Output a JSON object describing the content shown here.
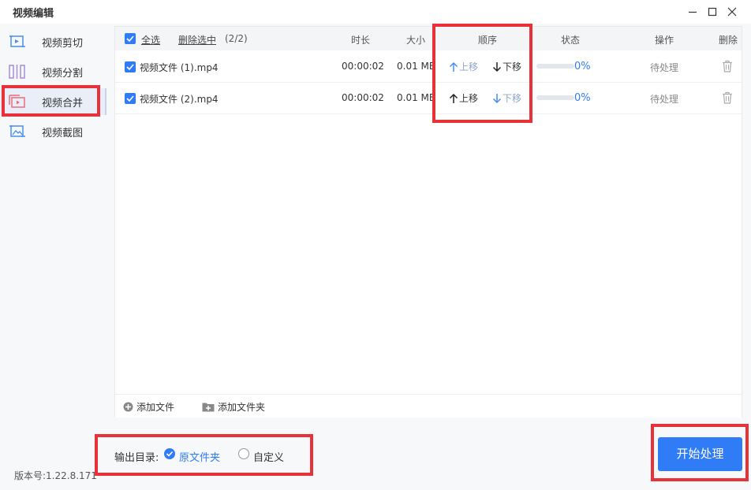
{
  "window": {
    "title": "视频编辑",
    "controls": [
      "minimize-icon",
      "maximize-icon",
      "close-icon"
    ]
  },
  "sidebar": {
    "items": [
      {
        "label": "视频剪切",
        "icon": "video-cut-icon"
      },
      {
        "label": "视频分割",
        "icon": "video-split-icon"
      },
      {
        "label": "视频合并",
        "icon": "video-merge-icon",
        "active": true
      },
      {
        "label": "视频截图",
        "icon": "video-screenshot-icon"
      }
    ]
  },
  "table": {
    "select_all": "全选",
    "delete_selected": "删除选中",
    "selected_count": "(2/2)",
    "columns": {
      "duration": "时长",
      "size": "大小",
      "order": "顺序",
      "status": "状态",
      "action": "操作",
      "delete": "删除"
    },
    "rows": [
      {
        "name": "视频文件 (1).mp4",
        "duration": "00:00:02",
        "size": "0.01 MB",
        "up": "上移",
        "down": "下移",
        "up_enabled": false,
        "down_enabled": true,
        "progress_percent": 0,
        "progress_text": "0%",
        "action": "待处理"
      },
      {
        "name": "视频文件 (2).mp4",
        "duration": "00:00:02",
        "size": "0.01 MB",
        "up": "上移",
        "down": "下移",
        "up_enabled": true,
        "down_enabled": false,
        "progress_percent": 0,
        "progress_text": "0%",
        "action": "待处理"
      }
    ]
  },
  "panel_footer": {
    "add_file": "添加文件",
    "add_folder": "添加文件夹"
  },
  "output": {
    "label": "输出目录:",
    "options": [
      {
        "label": "原文件夹",
        "selected": true
      },
      {
        "label": "自定义",
        "selected": false
      }
    ]
  },
  "version": "版本号:1.22.8.171",
  "start_button": "开始处理",
  "colors": {
    "accent": "#2f7cf6",
    "highlight_box": "#e8323a",
    "progress_track": "#e3e6ec"
  }
}
